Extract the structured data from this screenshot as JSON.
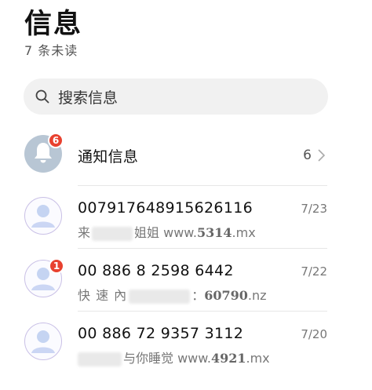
{
  "header": {
    "title": "信息",
    "unread": "7 条未读"
  },
  "search": {
    "placeholder": "搜索信息",
    "icon": "search-icon"
  },
  "notifications": {
    "title": "通知信息",
    "badge": "6",
    "count": "6",
    "icon": "bell-icon"
  },
  "conversations": [
    {
      "title": "007917648915626116",
      "date": "7/23",
      "preview_pre": "来",
      "preview_mid": "姐姐 www.",
      "preview_num": "5314",
      "preview_post": ".mx",
      "badge": ""
    },
    {
      "title": "00 886 8 2598 6442",
      "date": "7/22",
      "preview_pre": "快 速 內",
      "preview_mid": "：",
      "preview_num": "60790",
      "preview_post": ".nz",
      "badge": "1"
    },
    {
      "title": "00 886 72 9357 3112",
      "date": "7/20",
      "preview_pre": "",
      "preview_mid": "与你睡觉 www.",
      "preview_num": "4921",
      "preview_post": ".mx",
      "badge": ""
    }
  ],
  "colors": {
    "badge": "#e8412f",
    "avatar_notify": "#b8c6d4",
    "avatar_person_border": "#c9c0e6"
  }
}
